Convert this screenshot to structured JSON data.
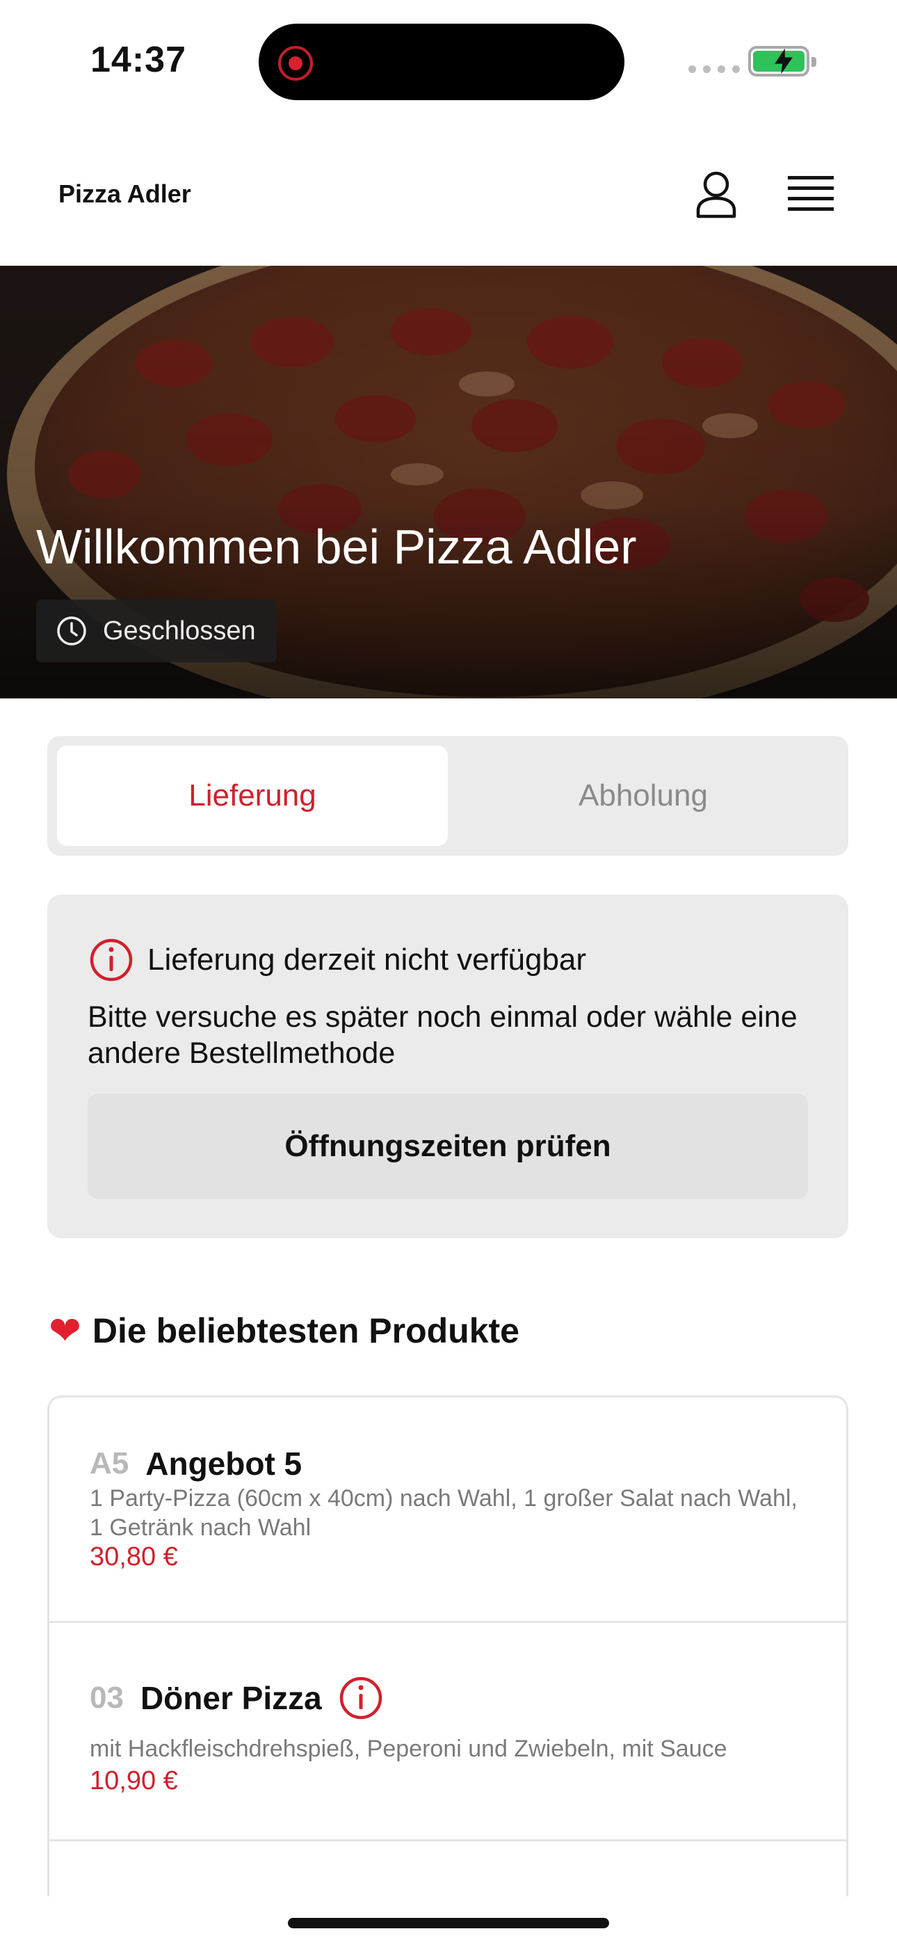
{
  "status_bar": {
    "time": "14:37"
  },
  "header": {
    "brand": "Pizza Adler"
  },
  "hero": {
    "title": "Willkommen bei Pizza Adler",
    "status_label": "Geschlossen"
  },
  "order_mode": {
    "options": [
      "Lieferung",
      "Abholung"
    ],
    "selected": "Lieferung"
  },
  "notice": {
    "title": "Lieferung derzeit nicht verfügbar",
    "text": "Bitte versuche es später noch einmal oder wähle eine andere Bestellmethode",
    "button_label": "Öffnungszeiten prüfen"
  },
  "popular": {
    "title": "Die beliebtesten Produkte",
    "products": [
      {
        "number": "A5",
        "name": "Angebot 5",
        "description": "1 Party-Pizza (60cm x 40cm) nach Wahl, 1 großer Salat nach Wahl, 1 Getränk nach Wahl",
        "price": "30,80 €"
      },
      {
        "number": "03",
        "name": "Döner Pizza",
        "description": "mit Hackfleischdrehspieß, Peperoni und Zwiebeln, mit Sauce",
        "price": "10,90 €"
      }
    ]
  },
  "colors": {
    "accent": "#d0202c",
    "card_bg": "#ebebeb",
    "battery": "#2fc15a"
  },
  "icons": [
    "clock-icon",
    "user-icon",
    "menu-icon",
    "info-icon",
    "heart-icon"
  ]
}
